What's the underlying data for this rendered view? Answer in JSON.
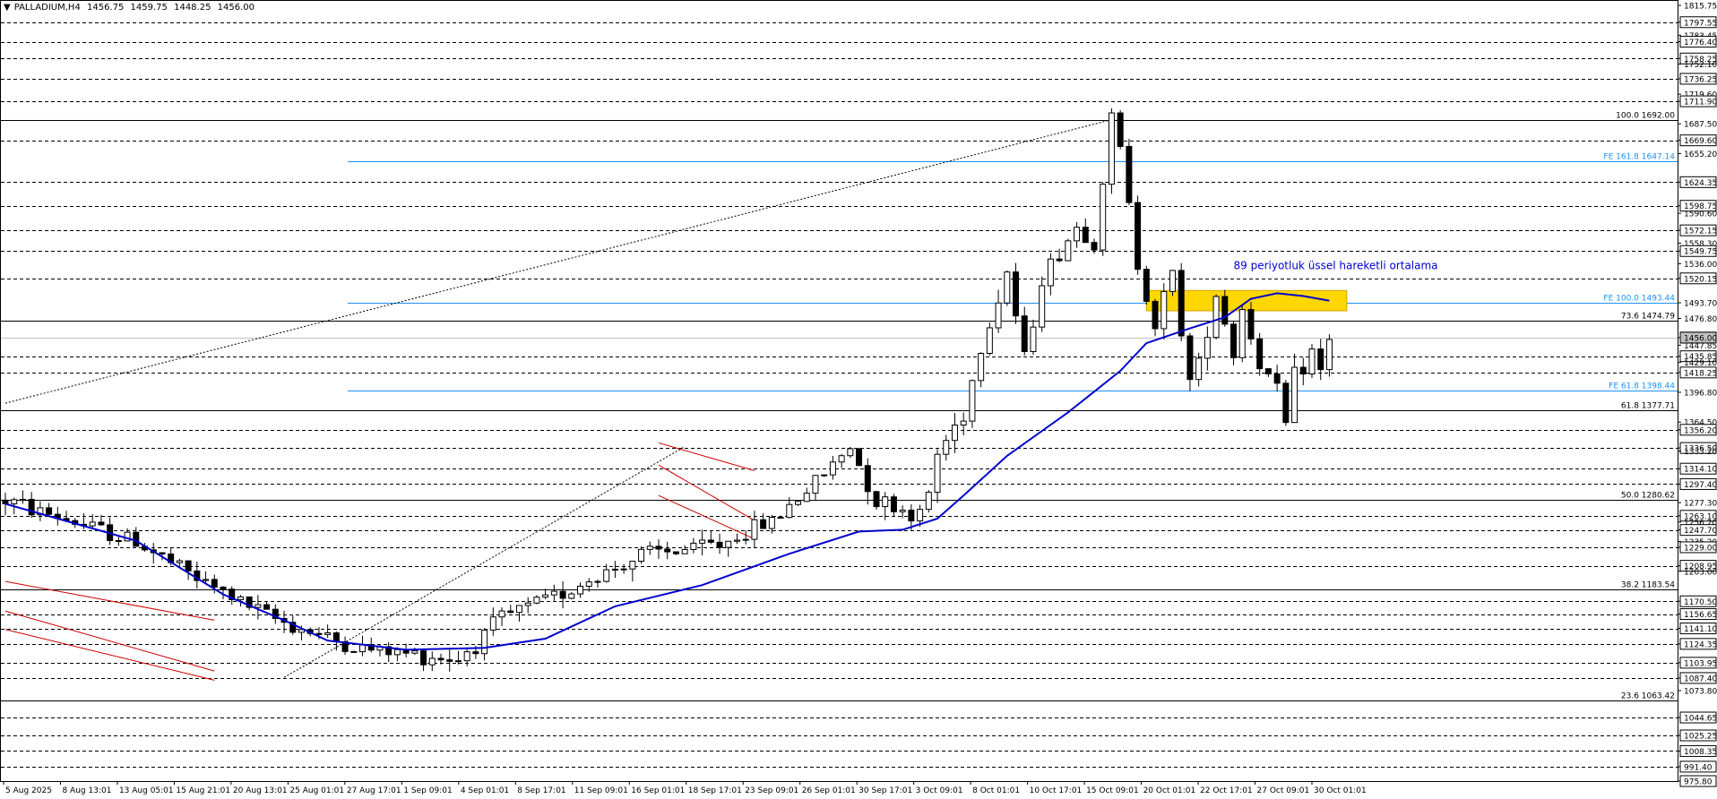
{
  "header": {
    "menu_icon": "triangle-down-icon",
    "symbol": "PALLADIUM,H4",
    "open": "1456.75",
    "high": "1459.75",
    "low": "1448.25",
    "close": "1456.00"
  },
  "colors": {
    "background": "#ffffff",
    "candle": "#000000",
    "ema": "#0000cd",
    "fe_line": "#1e90ff",
    "fib_line": "#000000",
    "channel": "#cc0000",
    "zone": "#ffd700",
    "annotation": "#0000cd"
  },
  "chart_data": {
    "type": "candlestick",
    "instrument": "PALLADIUM",
    "timeframe": "H4",
    "ylim": [
      975.8,
      1815.75
    ],
    "x_tick_labels": [
      "5 Aug 2025",
      "8 Aug 13:01",
      "13 Aug 05:01",
      "15 Aug 21:01",
      "20 Aug 13:01",
      "25 Aug 01:01",
      "27 Aug 17:01",
      "1 Sep 09:01",
      "4 Sep 01:01",
      "8 Sep 17:01",
      "11 Sep 09:01",
      "16 Sep 01:01",
      "18 Sep 17:01",
      "23 Sep 09:01",
      "26 Sep 01:01",
      "30 Sep 17:01",
      "3 Oct 09:01",
      "8 Oct 01:01",
      "10 Oct 17:01",
      "15 Oct 09:01",
      "20 Oct 01:01",
      "22 Oct 17:01",
      "27 Oct 09:01",
      "30 Oct 01:01"
    ],
    "price_axis_labels": [
      "1815.75",
      "1797.55",
      "1783.45",
      "1776.40",
      "1758.25",
      "1752.10",
      "1736.25",
      "1719.60",
      "1711.90",
      "1687.50",
      "1669.60",
      "1655.20",
      "1624.35",
      "1598.75",
      "1590.60",
      "1572.15",
      "1558.30",
      "1549.75",
      "1536.00",
      "1520.15",
      "1493.70",
      "1476.80",
      "1456.00",
      "1447.85",
      "1435.85",
      "1429.10",
      "1418.25",
      "1396.80",
      "1364.50",
      "1356.20",
      "1336.50",
      "1333.20",
      "1314.10",
      "1297.40",
      "1277.30",
      "1263.10",
      "1256.20",
      "1247.70",
      "1235.20",
      "1229.00",
      "1208.95",
      "1203.00",
      "1170.50",
      "1156.65",
      "1141.10",
      "1124.35",
      "1103.95",
      "1087.40",
      "1073.80",
      "1044.65",
      "1025.25",
      "1008.35",
      "991.40",
      "975.80"
    ],
    "price_axis_boxed": [
      "1797.55",
      "1776.40",
      "1758.25",
      "1736.25",
      "1711.90",
      "1669.60",
      "1624.35",
      "1598.75",
      "1572.15",
      "1549.75",
      "1520.15",
      "1456.00",
      "1435.85",
      "1418.25",
      "1356.20",
      "1336.50",
      "1314.10",
      "1297.40",
      "1263.10",
      "1247.70",
      "1229.00",
      "1208.95",
      "1170.50",
      "1156.65",
      "1141.10",
      "1124.35",
      "1103.95",
      "1087.40",
      "1044.65",
      "1025.25",
      "1008.35",
      "991.40",
      "975.80"
    ],
    "dashed_levels": [
      1797.55,
      1776.4,
      1758.25,
      1736.25,
      1711.9,
      1669.6,
      1624.35,
      1598.75,
      1572.15,
      1549.75,
      1520.15,
      1435.85,
      1418.25,
      1356.2,
      1336.5,
      1314.1,
      1297.4,
      1263.1,
      1247.7,
      1229.0,
      1208.95,
      1170.5,
      1156.65,
      1141.1,
      1124.35,
      1103.95,
      1087.4,
      1044.65,
      1025.25,
      1008.35,
      991.4,
      975.8
    ],
    "fib_retracement": [
      {
        "label": "100.0 1692.00",
        "value": 1692.0
      },
      {
        "label": "73.6 1474.79",
        "value": 1474.79
      },
      {
        "label": "61.8 1377.71",
        "value": 1377.71
      },
      {
        "label": "50.0 1280.62",
        "value": 1280.62
      },
      {
        "label": "38.2 1183.54",
        "value": 1183.54
      },
      {
        "label": "23.6 1063.42",
        "value": 1063.42
      }
    ],
    "fib_expansion": [
      {
        "label": "FE 161.8 1647.14",
        "value": 1647.14
      },
      {
        "label": "FE 100.0 1493.44",
        "value": 1493.44
      },
      {
        "label": "FE 61.8 1398.44",
        "value": 1398.44
      }
    ],
    "zone": {
      "from": 1485.0,
      "to": 1507.0
    },
    "current_price": 1456.0,
    "annotation": "89 periyotluk üssel hareketli ortalama",
    "anchors": [
      {
        "x": 0,
        "price": 1280
      },
      {
        "x": 15,
        "price": 1235
      },
      {
        "x": 22,
        "price": 1195
      },
      {
        "x": 30,
        "price": 1155
      },
      {
        "x": 40,
        "price": 1120
      },
      {
        "x": 52,
        "price": 1108
      },
      {
        "x": 57,
        "price": 1152
      },
      {
        "x": 64,
        "price": 1180
      },
      {
        "x": 73,
        "price": 1220
      },
      {
        "x": 82,
        "price": 1232
      },
      {
        "x": 88,
        "price": 1258
      },
      {
        "x": 92,
        "price": 1290
      },
      {
        "x": 97,
        "price": 1338
      },
      {
        "x": 100,
        "price": 1280
      },
      {
        "x": 103,
        "price": 1270
      },
      {
        "x": 105,
        "price": 1262
      },
      {
        "x": 106,
        "price": 1288
      },
      {
        "x": 107,
        "price": 1330
      },
      {
        "x": 110,
        "price": 1375
      },
      {
        "x": 112,
        "price": 1445
      },
      {
        "x": 115,
        "price": 1528
      },
      {
        "x": 117,
        "price": 1432
      },
      {
        "x": 119,
        "price": 1520
      },
      {
        "x": 123,
        "price": 1576
      },
      {
        "x": 125,
        "price": 1560
      },
      {
        "x": 127,
        "price": 1692
      },
      {
        "x": 128,
        "price": 1660
      },
      {
        "x": 130,
        "price": 1536
      },
      {
        "x": 132,
        "price": 1472
      },
      {
        "x": 134,
        "price": 1525
      },
      {
        "x": 135,
        "price": 1466
      },
      {
        "x": 136,
        "price": 1408
      },
      {
        "x": 137,
        "price": 1428
      },
      {
        "x": 139,
        "price": 1505
      },
      {
        "x": 141,
        "price": 1440
      },
      {
        "x": 142,
        "price": 1488
      },
      {
        "x": 144,
        "price": 1428
      },
      {
        "x": 146,
        "price": 1398
      },
      {
        "x": 147,
        "price": 1362
      },
      {
        "x": 148,
        "price": 1412
      },
      {
        "x": 150,
        "price": 1440
      },
      {
        "x": 151,
        "price": 1418
      },
      {
        "x": 152,
        "price": 1456
      }
    ],
    "ema_points": [
      {
        "x": 0,
        "price": 1276
      },
      {
        "x": 15,
        "price": 1236
      },
      {
        "x": 25,
        "price": 1178
      },
      {
        "x": 32,
        "price": 1150
      },
      {
        "x": 37,
        "price": 1128
      },
      {
        "x": 46,
        "price": 1118
      },
      {
        "x": 55,
        "price": 1120
      },
      {
        "x": 62,
        "price": 1130
      },
      {
        "x": 70,
        "price": 1165
      },
      {
        "x": 80,
        "price": 1188
      },
      {
        "x": 90,
        "price": 1222
      },
      {
        "x": 98,
        "price": 1246
      },
      {
        "x": 103,
        "price": 1248
      },
      {
        "x": 107,
        "price": 1260
      },
      {
        "x": 110,
        "price": 1285
      },
      {
        "x": 115,
        "price": 1328
      },
      {
        "x": 122,
        "price": 1375
      },
      {
        "x": 128,
        "price": 1420
      },
      {
        "x": 131,
        "price": 1450
      },
      {
        "x": 136,
        "price": 1466
      },
      {
        "x": 140,
        "price": 1478
      },
      {
        "x": 143,
        "price": 1498
      },
      {
        "x": 146,
        "price": 1504
      },
      {
        "x": 149,
        "price": 1501
      },
      {
        "x": 152,
        "price": 1496
      }
    ]
  }
}
